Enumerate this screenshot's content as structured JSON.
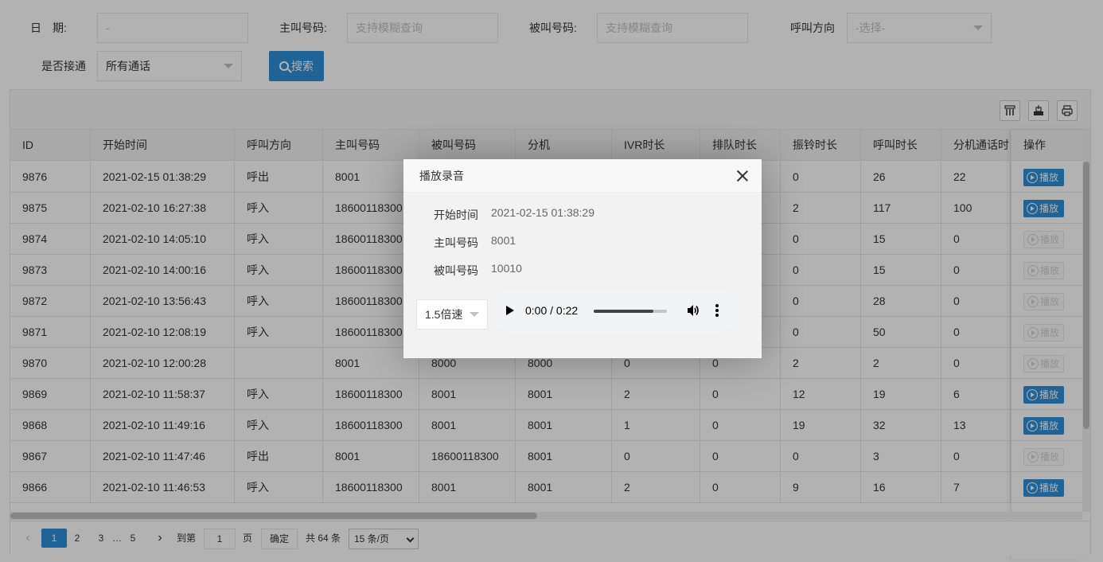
{
  "filters": {
    "date_label": "日　期:",
    "date_value": "-",
    "caller_label": "主叫号码:",
    "caller_placeholder": "支持模糊查询",
    "callee_label": "被叫号码:",
    "callee_placeholder": "支持模糊查询",
    "direction_label": "呼叫方向",
    "direction_value": "-选择-",
    "connected_label": "是否接通",
    "connected_value": "所有通话",
    "search_label": "搜索"
  },
  "toolbar": {
    "icons": [
      "columns-icon",
      "export-icon",
      "print-icon"
    ]
  },
  "table": {
    "headers": [
      "ID",
      "开始时间",
      "呼叫方向",
      "主叫号码",
      "被叫号码",
      "分机",
      "IVR时长",
      "排队时长",
      "振铃时长",
      "呼叫时长",
      "分机通话时"
    ],
    "action_header": "操作",
    "rows": [
      {
        "id": "9876",
        "start": "2021-02-15 01:38:29",
        "dir": "呼出",
        "caller": "8001",
        "callee": "",
        "ext": "",
        "ivr": "",
        "queue": "",
        "ring": "0",
        "call": "26",
        "talk": "22",
        "play_enabled": true
      },
      {
        "id": "9875",
        "start": "2021-02-10 16:27:38",
        "dir": "呼入",
        "caller": "18600118300",
        "callee": "",
        "ext": "",
        "ivr": "",
        "queue": "",
        "ring": "2",
        "call": "117",
        "talk": "100",
        "play_enabled": true
      },
      {
        "id": "9874",
        "start": "2021-02-10 14:05:10",
        "dir": "呼入",
        "caller": "18600118300",
        "callee": "",
        "ext": "",
        "ivr": "",
        "queue": "",
        "ring": "0",
        "call": "15",
        "talk": "0",
        "play_enabled": false
      },
      {
        "id": "9873",
        "start": "2021-02-10 14:00:16",
        "dir": "呼入",
        "caller": "18600118300",
        "callee": "",
        "ext": "",
        "ivr": "",
        "queue": "",
        "ring": "0",
        "call": "15",
        "talk": "0",
        "play_enabled": false
      },
      {
        "id": "9872",
        "start": "2021-02-10 13:56:43",
        "dir": "呼入",
        "caller": "18600118300",
        "callee": "",
        "ext": "",
        "ivr": "",
        "queue": "",
        "ring": "0",
        "call": "28",
        "talk": "0",
        "play_enabled": false
      },
      {
        "id": "9871",
        "start": "2021-02-10 12:08:19",
        "dir": "呼入",
        "caller": "18600118300",
        "callee": "",
        "ext": "",
        "ivr": "",
        "queue": "",
        "ring": "0",
        "call": "50",
        "talk": "0",
        "play_enabled": false
      },
      {
        "id": "9870",
        "start": "2021-02-10 12:00:28",
        "dir": "",
        "caller": "8001",
        "callee": "8000",
        "ext": "8000",
        "ivr": "0",
        "queue": "0",
        "ring": "2",
        "call": "2",
        "talk": "0",
        "play_enabled": false
      },
      {
        "id": "9869",
        "start": "2021-02-10 11:58:37",
        "dir": "呼入",
        "caller": "18600118300",
        "callee": "8001",
        "ext": "8001",
        "ivr": "2",
        "queue": "0",
        "ring": "12",
        "call": "19",
        "talk": "6",
        "play_enabled": true
      },
      {
        "id": "9868",
        "start": "2021-02-10 11:49:16",
        "dir": "呼入",
        "caller": "18600118300",
        "callee": "8001",
        "ext": "8001",
        "ivr": "1",
        "queue": "0",
        "ring": "19",
        "call": "32",
        "talk": "13",
        "play_enabled": true
      },
      {
        "id": "9867",
        "start": "2021-02-10 11:47:46",
        "dir": "呼出",
        "caller": "8001",
        "callee": "18600118300",
        "ext": "8001",
        "ivr": "0",
        "queue": "0",
        "ring": "0",
        "call": "3",
        "talk": "0",
        "play_enabled": false
      },
      {
        "id": "9866",
        "start": "2021-02-10 11:46:53",
        "dir": "呼入",
        "caller": "18600118300",
        "callee": "8001",
        "ext": "8001",
        "ivr": "2",
        "queue": "0",
        "ring": "9",
        "call": "16",
        "talk": "7",
        "play_enabled": true
      }
    ],
    "play_label": "播放"
  },
  "pager": {
    "pages": [
      "1",
      "2",
      "3",
      "…",
      "5"
    ],
    "current": "1",
    "goto_label": "到第",
    "goto_value": "1",
    "page_unit": "页",
    "confirm_label": "确定",
    "total": "共 64 条",
    "page_size": "15 条/页"
  },
  "dialog": {
    "title": "播放录音",
    "start_label": "开始时间",
    "start_value": "2021-02-15 01:38:29",
    "caller_label": "主叫号码",
    "caller_value": "8001",
    "callee_label": "被叫号码",
    "callee_value": "10010",
    "speed_value": "1.5倍速",
    "time": "0:00 / 0:22",
    "buffered_fraction": 0.82
  }
}
